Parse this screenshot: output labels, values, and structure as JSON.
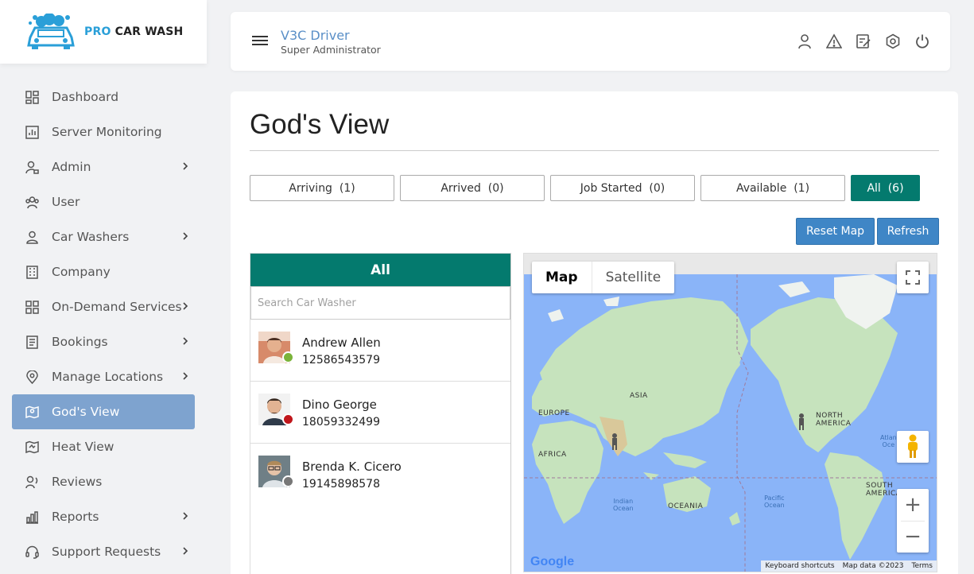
{
  "brand": {
    "pro": "PRO",
    "rest": "CAR WASH"
  },
  "sidebar": {
    "items": [
      {
        "label": "Dashboard",
        "icon": "dashboard-icon",
        "submenu": false
      },
      {
        "label": "Server Monitoring",
        "icon": "chart-icon",
        "submenu": false
      },
      {
        "label": "Admin",
        "icon": "admin-icon",
        "submenu": true
      },
      {
        "label": "User",
        "icon": "users-icon",
        "submenu": false
      },
      {
        "label": "Car Washers",
        "icon": "person-icon",
        "submenu": true
      },
      {
        "label": "Company",
        "icon": "building-icon",
        "submenu": false
      },
      {
        "label": "On-Demand Services",
        "icon": "grid-icon",
        "submenu": true
      },
      {
        "label": "Bookings",
        "icon": "document-icon",
        "submenu": true
      },
      {
        "label": "Manage Locations",
        "icon": "location-icon",
        "submenu": true
      },
      {
        "label": "God's View",
        "icon": "map-pin-icon",
        "submenu": false,
        "active": true
      },
      {
        "label": "Heat View",
        "icon": "heat-map-icon",
        "submenu": false
      },
      {
        "label": "Reviews",
        "icon": "reviews-icon",
        "submenu": false
      },
      {
        "label": "Reports",
        "icon": "bar-chart-icon",
        "submenu": true
      },
      {
        "label": "Support Requests",
        "icon": "headset-icon",
        "submenu": true
      }
    ]
  },
  "header": {
    "user_name": "V3C Driver",
    "user_role": "Super Administrator",
    "icons": [
      "profile-icon",
      "alert-icon",
      "edit-icon",
      "settings-icon",
      "power-icon"
    ]
  },
  "page": {
    "title": "God's View",
    "filters": [
      {
        "label": "Arriving",
        "count": "(1)"
      },
      {
        "label": "Arrived",
        "count": "(0)"
      },
      {
        "label": "Job Started",
        "count": "(0)"
      },
      {
        "label": "Available",
        "count": "(1)"
      },
      {
        "label": "All",
        "count": "(6)",
        "active": true
      }
    ],
    "reset_label": "Reset Map",
    "refresh_label": "Refresh"
  },
  "list": {
    "header": "All",
    "search_placeholder": "Search Car Washer",
    "drivers": [
      {
        "name": "Andrew Allen",
        "phone": "12586543579",
        "status_color": "#7bb33a"
      },
      {
        "name": "Dino George",
        "phone": "18059332499",
        "status_color": "#c0161b"
      },
      {
        "name": "Brenda K. Cicero",
        "phone": "19145898578",
        "status_color": "#777777"
      }
    ]
  },
  "map": {
    "type_map": "Map",
    "type_satellite": "Satellite",
    "labels": {
      "asia": "ASIA",
      "europe": "EUROPE",
      "africa": "AFRICA",
      "oceania": "OCEANIA",
      "north_america_1": "NORTH",
      "north_america_2": "AMERICA",
      "south_america_1": "SOUTH",
      "south_america_2": "AMERICA",
      "indian_1": "Indian",
      "indian_2": "Ocean",
      "pacific_1": "Pacific",
      "pacific_2": "Ocean",
      "atlantic_1": "Atlan",
      "atlantic_2": "Oce"
    },
    "google": "Google",
    "attribution": [
      "Keyboard shortcuts",
      "Map data ©2023",
      "Terms"
    ],
    "colors": {
      "water": "#8ab4f8",
      "land": "#bfe0b8"
    }
  }
}
